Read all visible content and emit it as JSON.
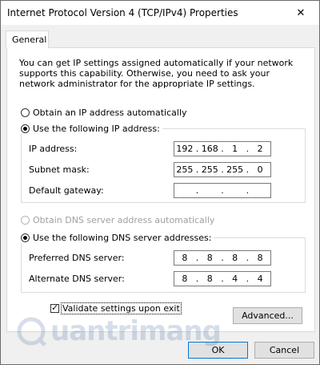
{
  "window": {
    "title": "Internet Protocol Version 4 (TCP/IPv4) Properties",
    "close_glyph": "✕"
  },
  "tabs": [
    {
      "label": "General"
    }
  ],
  "general": {
    "description": "You can get IP settings assigned automatically if your network supports this capability. Otherwise, you need to ask your network administrator for the appropriate IP settings.",
    "ip_mode": {
      "auto_label": "Obtain an IP address automatically",
      "manual_label": "Use the following IP address:",
      "selected": "manual"
    },
    "ip_fields": {
      "ip_address": {
        "label": "IP address:",
        "octets": [
          "192",
          "168",
          "1",
          "2"
        ]
      },
      "subnet_mask": {
        "label": "Subnet mask:",
        "octets": [
          "255",
          "255",
          "255",
          "0"
        ]
      },
      "default_gateway": {
        "label": "Default gateway:",
        "octets": [
          "",
          "",
          "",
          ""
        ]
      }
    },
    "dns_mode": {
      "auto_label": "Obtain DNS server address automatically",
      "manual_label": "Use the following DNS server addresses:",
      "selected": "manual"
    },
    "dns_fields": {
      "preferred": {
        "label": "Preferred DNS server:",
        "octets": [
          "8",
          "8",
          "8",
          "8"
        ]
      },
      "alternate": {
        "label": "Alternate DNS server:",
        "octets": [
          "8",
          "8",
          "4",
          "4"
        ]
      }
    },
    "validate": {
      "label": "Validate settings upon exit",
      "checked": true
    },
    "advanced_label": "Advanced..."
  },
  "buttons": {
    "ok": "OK",
    "cancel": "Cancel"
  },
  "watermark": {
    "text": "uantrimang",
    "icon": "quantrimang-logo-icon"
  },
  "colors": {
    "accent": "#0078d7",
    "panel_bg": "#ffffff",
    "window_bg": "#f0f0f0"
  }
}
